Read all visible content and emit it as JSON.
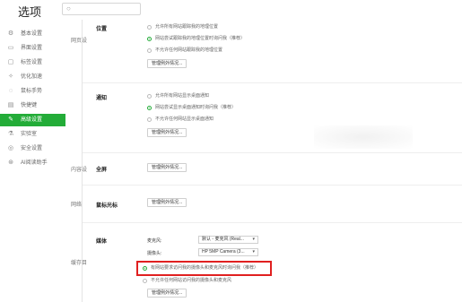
{
  "app": {
    "title": "选项",
    "search_placeholder": "",
    "search_icon": "search-icon"
  },
  "sidebar": {
    "items": [
      {
        "label": "基本设置",
        "icon": "gear-icon",
        "glyph": "⚙"
      },
      {
        "label": "界面设置",
        "icon": "window-icon",
        "glyph": "▭"
      },
      {
        "label": "标签设置",
        "icon": "tab-icon",
        "glyph": "▢"
      },
      {
        "label": "优化加速",
        "icon": "rocket-icon",
        "glyph": "✧"
      },
      {
        "label": "鼠标手势",
        "icon": "mouse-icon",
        "glyph": "◌"
      },
      {
        "label": "快捷键",
        "icon": "keyboard-icon",
        "glyph": "▤"
      },
      {
        "label": "高级设置",
        "icon": "tools-icon",
        "glyph": "✎",
        "active": true
      },
      {
        "label": "实验室",
        "icon": "flask-icon",
        "glyph": "⚗"
      },
      {
        "label": "安全设置",
        "icon": "shield-icon",
        "glyph": "◎"
      },
      {
        "label": "AI阅读助手",
        "icon": "ai-icon",
        "glyph": "⊛"
      }
    ]
  },
  "sections": {
    "web": "网页设",
    "content": "内容设",
    "network": "网络",
    "cache": "缓存目"
  },
  "location": {
    "title": "位置",
    "options": [
      "允许所有网站跟踪我的地理位置",
      "网站尝试跟踪我的地理位置时询问我（推荐）",
      "不允许任何网站跟踪我的地理位置"
    ],
    "manage": "管理例外情况..."
  },
  "notification": {
    "title": "通知",
    "options": [
      "允许所有网站显示桌面通知",
      "网站尝试显示桌面通知时询问我（推荐）",
      "不允许任何网站显示桌面通知"
    ],
    "manage": "管理例外情况..."
  },
  "fullscreen": {
    "title": "全屏",
    "manage": "管理例外情况..."
  },
  "pointer": {
    "title": "鼠标光标",
    "manage": "管理例外情况..."
  },
  "media": {
    "title": "媒体",
    "mic_label": "麦克风:",
    "mic_value": "默认 - 麦克风 (Real...",
    "cam_label": "摄像头:",
    "cam_value": "HP 5MP Camera (3...",
    "options": [
      "有网站要求访问我的摄像头和麦克风时询问我（推荐）",
      "不允许任何网站访问我的摄像头和麦克风"
    ],
    "manage": "管理例外情况..."
  },
  "colors": {
    "accent": "#23ac38",
    "highlight": "#e02020"
  }
}
